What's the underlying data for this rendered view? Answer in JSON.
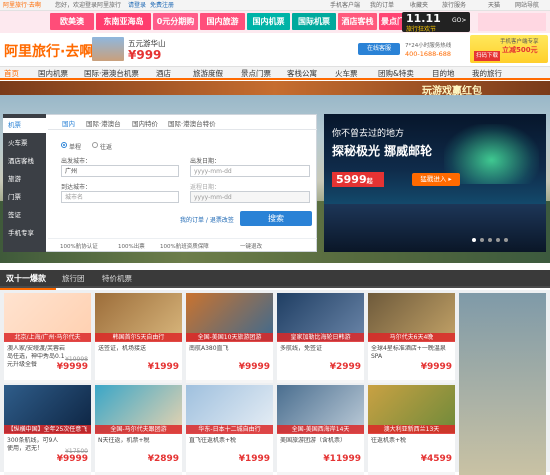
{
  "topbar": {
    "welcome": "阿里旅行·去啊",
    "hint": "您好，欢迎登录阿里旅行",
    "login": "请登录",
    "register": "免费注册",
    "mobile": "手机客户端",
    "orders": "我的订单",
    "favorites": "收藏夹",
    "services": "旅行服务",
    "tmall": "天猫",
    "sitenav": "网站导航"
  },
  "promo": {
    "tabs": [
      {
        "label": "欧美澳",
        "color": "#ff4d79"
      },
      {
        "label": "东南亚海岛",
        "color": "#ff3d6e"
      },
      {
        "label": "0元分期购",
        "color": "#ff5c8a"
      },
      {
        "label": "国内旅游",
        "color": "#ff4f7b"
      },
      {
        "label": "国内机票",
        "color": "#00b3a7"
      },
      {
        "label": "国际机票",
        "color": "#00a99d"
      },
      {
        "label": "酒店客栈",
        "color": "#ff5a7d"
      },
      {
        "label": "景点门票",
        "color": "#ff4473"
      }
    ],
    "go": "GO>",
    "big_label": "旅行狂欢节",
    "num": "11.11"
  },
  "header": {
    "logo": "阿里旅行·去啊",
    "slogan": "五元游华山",
    "price": "¥999",
    "service_btn": "在线客服",
    "hotline_label": "7*24小时服务热线",
    "hotline": "400-1688-688",
    "phone_label": "手机客户端专享",
    "phone_price": "立减500元",
    "phone_btn": "扫码下载"
  },
  "nav": {
    "items": [
      "首页",
      "国内机票",
      "国际·港澳台机票",
      "酒店",
      "旅游度假",
      "景点门票",
      "客栈公寓",
      "火车票",
      "团购&特卖",
      "目的地",
      "我的旅行"
    ]
  },
  "banner": {
    "strip": "玩游戏赢红包"
  },
  "booking": {
    "side": [
      "机票",
      "火车票",
      "酒店客栈",
      "旅游",
      "门票",
      "签证",
      "手机专享"
    ],
    "tabs": [
      "国内",
      "国际·港澳台",
      "国内特价",
      "国际·港澳台特价"
    ],
    "trip_one": "单程",
    "trip_round": "往返",
    "from_label": "出发城市：",
    "from_value": "广州",
    "to_label": "到达城市：",
    "to_placeholder": "城市名",
    "date_label": "出发日期：",
    "date_placeholder": "yyyy-mm-dd",
    "return_label": "返程日期：",
    "return_placeholder": "yyyy-mm-dd",
    "links": "我的订单 / 退票改签",
    "search": "搜索",
    "footer": [
      "100%航协认证",
      "100%出票",
      "100%航班资质保障",
      "一键退改"
    ]
  },
  "ad": {
    "line1": "你不曾去过的地方",
    "line2": "探秘极光 挪威邮轮",
    "price": "5999",
    "price_suffix": "起",
    "btn": "猛戳进入 ▸"
  },
  "section": {
    "tabs": [
      "双十一爆款",
      "旅行团",
      "特价机票"
    ]
  },
  "cards": [
    {
      "caption": "北京/上海/广州·马尔代夫",
      "desc1": "澳人家/安缦渡/芙蓉岩",
      "desc2": "岛任选，神中秀岛0.1",
      "desc3": "元升级全餐",
      "old": "¥19998",
      "price": "¥9999",
      "c1": "#ffe3d0",
      "c2": "#ffd0b0"
    },
    {
      "caption": "韩国首尔5天自由行",
      "desc1": "送签证，机场接送",
      "desc2": "",
      "desc3": "",
      "old": "",
      "price": "¥1999",
      "c1": "#9c6d3a",
      "c2": "#d8b67c"
    },
    {
      "caption": "全国-美国10天旅游团游",
      "desc1": "南航A380直飞",
      "desc2": "",
      "desc3": "",
      "old": "",
      "price": "¥9999",
      "c1": "#c9732f",
      "c2": "#3e6a8f"
    },
    {
      "caption": "皇家加勒比海轮日韩游",
      "desc1": "多航线，免签证",
      "desc2": "",
      "desc3": "",
      "old": "",
      "price": "¥2999",
      "c1": "#1f3e63",
      "c2": "#6a85a8"
    },
    {
      "caption": "马尔代夫6天4晚",
      "desc1": "全球4星标准酒店+一晚温泉",
      "desc2": "SPA",
      "desc3": "",
      "old": "",
      "price": "¥9999",
      "c1": "#6e5a3b",
      "c2": "#c2a267"
    },
    {
      "caption": "【纵横中国】全年25次任意飞",
      "desc1": "300条航线，可9人",
      "desc2": "使用，迟无！",
      "desc3": "",
      "old": "¥17500",
      "price": "¥9999",
      "c1": "#2f5d8a",
      "c2": "#0d2442"
    },
    {
      "caption": "全国-马尔代夫跟团游",
      "desc1": "N天往返，机票+税",
      "desc2": "",
      "desc3": "",
      "old": "",
      "price": "¥2899",
      "c1": "#3aa6c7",
      "c2": "#e7d3b0"
    },
    {
      "caption": "华东-日本十二城自由行",
      "desc1": "直飞往返机票+税",
      "desc2": "",
      "desc3": "",
      "old": "",
      "price": "¥1999",
      "c1": "#9fc0de",
      "c2": "#e7eef5"
    },
    {
      "caption": "全国-美国西海岸14天",
      "desc1": "美国旅游团游（含机票）",
      "desc2": "",
      "desc3": "",
      "old": "",
      "price": "¥11999",
      "c1": "#4a6e8f",
      "c2": "#bccbd8"
    },
    {
      "caption": "澳大利亚新西兰13天",
      "desc1": "往返机票+税",
      "desc2": "",
      "desc3": "",
      "old": "",
      "price": "¥4599",
      "c1": "#c9a143",
      "c2": "#6e8a3a"
    }
  ]
}
